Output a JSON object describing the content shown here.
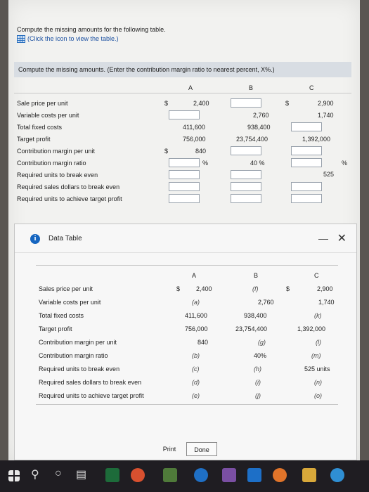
{
  "prompt": {
    "line1": "Compute the missing amounts for the following table.",
    "link": "(Click the icon to view the table.)"
  },
  "instruction": "Compute the missing amounts. (Enter the contribution margin ratio to nearest percent, X%.)",
  "top_table": {
    "headers": [
      "A",
      "B",
      "C"
    ],
    "rows": [
      {
        "label": "Sale price per unit",
        "a_prefix": "$",
        "a": "2,400",
        "b": "",
        "c_prefix": "$",
        "c": "2,900"
      },
      {
        "label": "Variable costs per unit",
        "a": "",
        "b": "2,760",
        "c": "1,740"
      },
      {
        "label": "Total fixed costs",
        "a": "411,600",
        "b": "938,400",
        "c": ""
      },
      {
        "label": "Target profit",
        "a": "756,000",
        "b": "23,754,400",
        "c": "1,392,000"
      },
      {
        "label": "Contribution margin per unit",
        "a_prefix": "$",
        "a": "840",
        "b": "",
        "c": ""
      },
      {
        "label": "Contribution margin ratio",
        "a_suffix": "%",
        "b": "40 %",
        "c_suffix": "%"
      },
      {
        "label": "Required units to break even",
        "a": "",
        "b": "",
        "c": "525"
      },
      {
        "label": "Required sales dollars to break even",
        "a": "",
        "b": "",
        "c": ""
      },
      {
        "label": "Required units to achieve target profit",
        "a": "",
        "b": "",
        "c": ""
      }
    ]
  },
  "modal": {
    "title": "Data Table",
    "headers": [
      "A",
      "B",
      "C"
    ],
    "rows": [
      {
        "label": "Sales price per unit",
        "a_prefix": "$",
        "a": "2,400",
        "b": "(f)",
        "c_prefix": "$",
        "c": "2,900"
      },
      {
        "label": "Variable costs per unit",
        "a": "(a)",
        "b": "2,760",
        "c": "1,740"
      },
      {
        "label": "Total fixed costs",
        "a": "411,600",
        "b": "938,400",
        "c": "(k)"
      },
      {
        "label": "Target profit",
        "a": "756,000",
        "b": "23,754,400",
        "c": "1,392,000"
      },
      {
        "label": "Contribution margin per unit",
        "a": "840",
        "b": "(g)",
        "c": "(l)"
      },
      {
        "label": "Contribution margin ratio",
        "a": "(b)",
        "b": "40%",
        "c": "(m)"
      },
      {
        "label": "Required units to break even",
        "a": "(c)",
        "b": "(h)",
        "c": "525 units"
      },
      {
        "label": "Required sales dollars to break even",
        "a": "(d)",
        "b": "(i)",
        "c": "(n)"
      },
      {
        "label": "Required units to achieve target profit",
        "a": "(e)",
        "b": "(j)",
        "c": "(o)"
      }
    ],
    "print_label": "Print",
    "done_label": "Done"
  },
  "taskbar": {
    "icons": [
      "windows-icon",
      "search-icon",
      "task-view-icon",
      "apps-icon",
      "excel-icon",
      "chrome-icon",
      "minecraft-icon",
      "edge-icon",
      "game-icon",
      "outlook-icon",
      "firefox-icon",
      "file-explorer-icon",
      "chrome-icon"
    ]
  }
}
